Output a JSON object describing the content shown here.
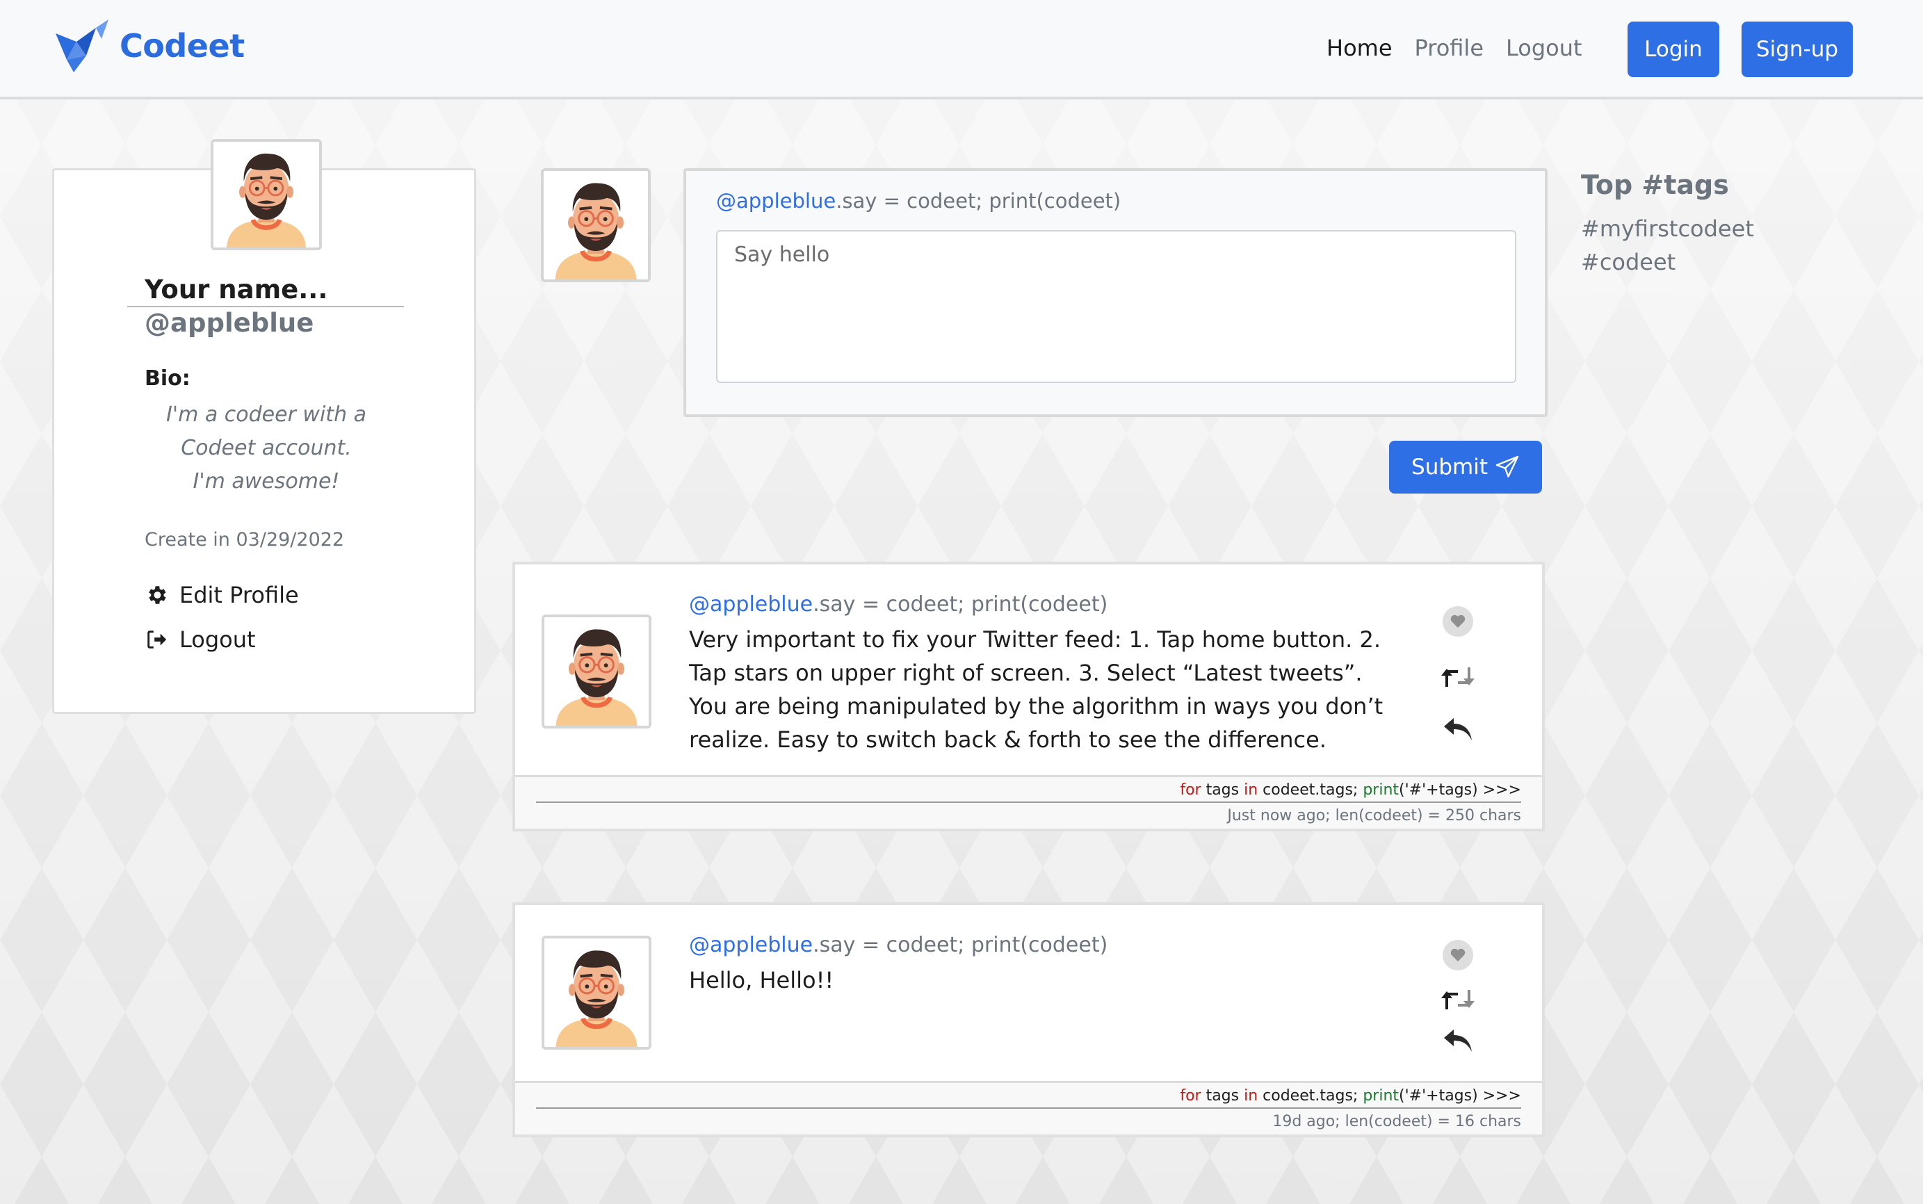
{
  "navbar": {
    "brand": "Codeet",
    "links": [
      "Home",
      "Profile",
      "Logout"
    ],
    "login_label": "Login",
    "signup_label": "Sign-up"
  },
  "profile": {
    "name": "Your name...",
    "handle": "@appleblue",
    "bio_label": "Bio:",
    "bio": "I'm a codeer with a Codeet account. I'm awesome!",
    "created": "Create in 03/29/2022",
    "edit_label": "Edit Profile",
    "logout_label": "Logout"
  },
  "compose": {
    "handle": "@appleblue",
    "say_suffix": ".say = codeet; print(codeet)",
    "placeholder": "Say hello",
    "submit_label": "Submit"
  },
  "tags": {
    "title": "Top #tags",
    "items": [
      "#myfirstcodeet",
      "#codeet"
    ]
  },
  "posts": [
    {
      "handle": "@appleblue",
      "say_suffix": ".say = codeet; print(codeet)",
      "text": "Very important to fix your Twitter feed: 1. Tap home button. 2. Tap stars on upper right of screen. 3. Select “Latest tweets”. You are being manipulated by the algorithm in ways you don’t realize. Easy to switch back & forth to see the difference.",
      "code": {
        "kw_for": "for",
        "t1": " tags ",
        "kw_in": "in",
        "t2": " codeet.tags; ",
        "fn": "print",
        "t3": "('#'+tags) >>>"
      },
      "meta": "Just now ago; len(codeet) = 250 chars"
    },
    {
      "handle": "@appleblue",
      "say_suffix": ".say = codeet; print(codeet)",
      "text": "Hello, Hello!!",
      "code": {
        "kw_for": "for",
        "t1": " tags ",
        "kw_in": "in",
        "t2": " codeet.tags; ",
        "fn": "print",
        "t3": "('#'+tags) >>>"
      },
      "meta": "19d ago; len(codeet) = 16 chars"
    }
  ],
  "icons": {
    "brand": "origami-bird-logo",
    "edit": "gear-icon",
    "logout": "sign-out-icon",
    "submit": "paper-plane-icon",
    "like": "heart-icon",
    "retweet": "retweet-icon",
    "reply": "reply-icon"
  },
  "colors": {
    "accent": "#2f6fe6",
    "muted": "#6c757d"
  }
}
